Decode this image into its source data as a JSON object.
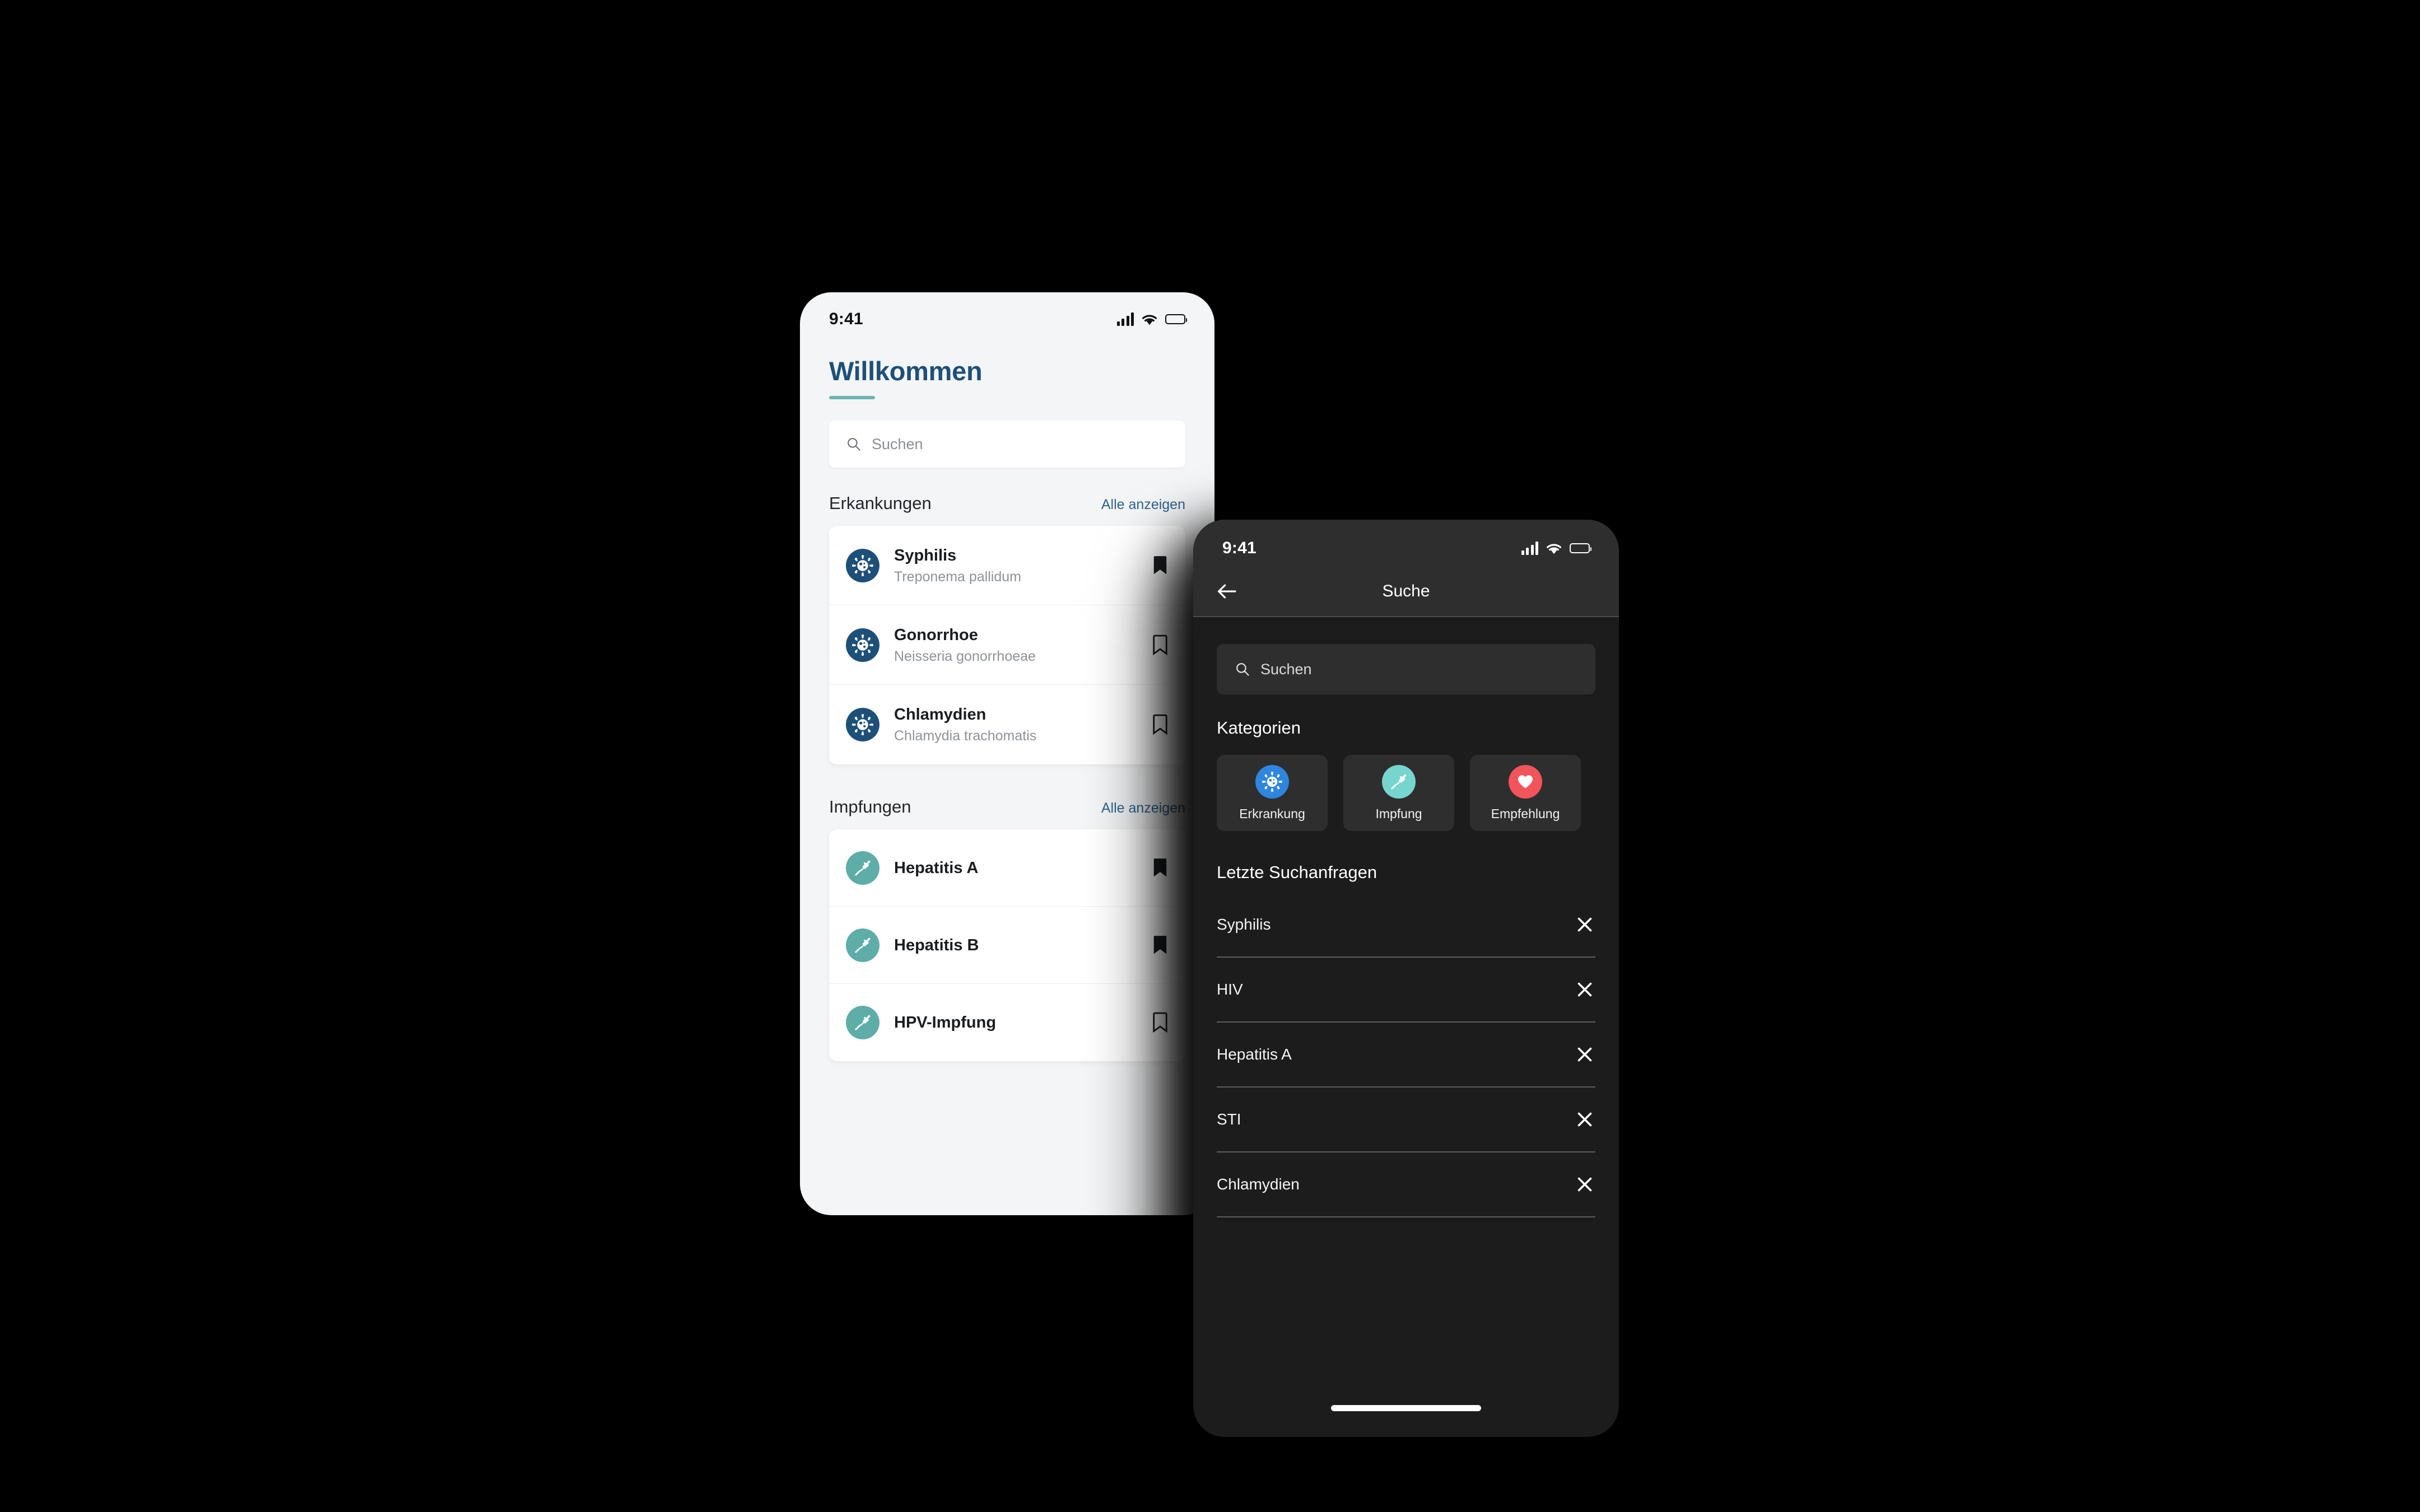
{
  "light_phone": {
    "status_bar": {
      "time": "9:41",
      "signal_icon": "cellular-signal-icon",
      "wifi_icon": "wifi-icon",
      "battery_icon": "battery-icon"
    },
    "welcome_title": "Willkommen",
    "search": {
      "placeholder": "Suchen",
      "icon": "search-icon"
    },
    "sections": [
      {
        "title": "Erkankungen",
        "link_label": "Alle anzeigen",
        "items": [
          {
            "title": "Syphilis",
            "subtitle": "Treponema pallidum",
            "icon": "virus-icon",
            "bookmark": "filled"
          },
          {
            "title": "Gonorrhoe",
            "subtitle": "Neisseria gonorrhoeae",
            "icon": "virus-icon",
            "bookmark": "outline"
          },
          {
            "title": "Chlamydien",
            "subtitle": "Chlamydia trachomatis",
            "icon": "virus-icon",
            "bookmark": "outline"
          }
        ]
      },
      {
        "title": "Impfungen",
        "link_label": "Alle anzeigen",
        "items": [
          {
            "title": "Hepatitis A",
            "subtitle": "",
            "icon": "syringe-icon",
            "bookmark": "filled"
          },
          {
            "title": "Hepatitis B",
            "subtitle": "",
            "icon": "syringe-icon",
            "bookmark": "filled"
          },
          {
            "title": "HPV-Impfung",
            "subtitle": "",
            "icon": "syringe-icon",
            "bookmark": "outline"
          }
        ]
      }
    ]
  },
  "dark_phone": {
    "status_bar": {
      "time": "9:41",
      "signal_icon": "cellular-signal-icon",
      "wifi_icon": "wifi-icon",
      "battery_icon": "battery-icon"
    },
    "navbar": {
      "title": "Suche",
      "back_icon": "arrow-left-icon"
    },
    "search": {
      "placeholder": "Suchen",
      "icon": "search-icon"
    },
    "categories_title": "Kategorien",
    "categories": [
      {
        "label": "Erkrankung",
        "icon": "virus-icon",
        "color": "#2e86de"
      },
      {
        "label": "Impfung",
        "icon": "syringe-icon",
        "color": "#76d5ce"
      },
      {
        "label": "Empfehlung",
        "icon": "heart-icon",
        "color": "#f1545a"
      }
    ],
    "recent_title": "Letzte Suchanfragen",
    "recent_queries": [
      {
        "label": "Syphilis",
        "remove_icon": "close-icon"
      },
      {
        "label": "HIV",
        "remove_icon": "close-icon"
      },
      {
        "label": "Hepatitis A",
        "remove_icon": "close-icon"
      },
      {
        "label": "STI",
        "remove_icon": "close-icon"
      },
      {
        "label": "Chlamydien",
        "remove_icon": "close-icon"
      }
    ],
    "home_indicator": "home-indicator"
  },
  "theme": {
    "brand_blue": "#1d5079",
    "brand_teal": "#6cb4af",
    "link_blue": "#2d648f",
    "dark_bg": "#1c1c1c",
    "dark_surface": "#2e2e2e",
    "light_bg": "#f4f5f6",
    "card_white": "#ffffff",
    "accent_red": "#f1545a",
    "accent_blue": "#2e86de",
    "accent_teal": "#76d5ce"
  }
}
